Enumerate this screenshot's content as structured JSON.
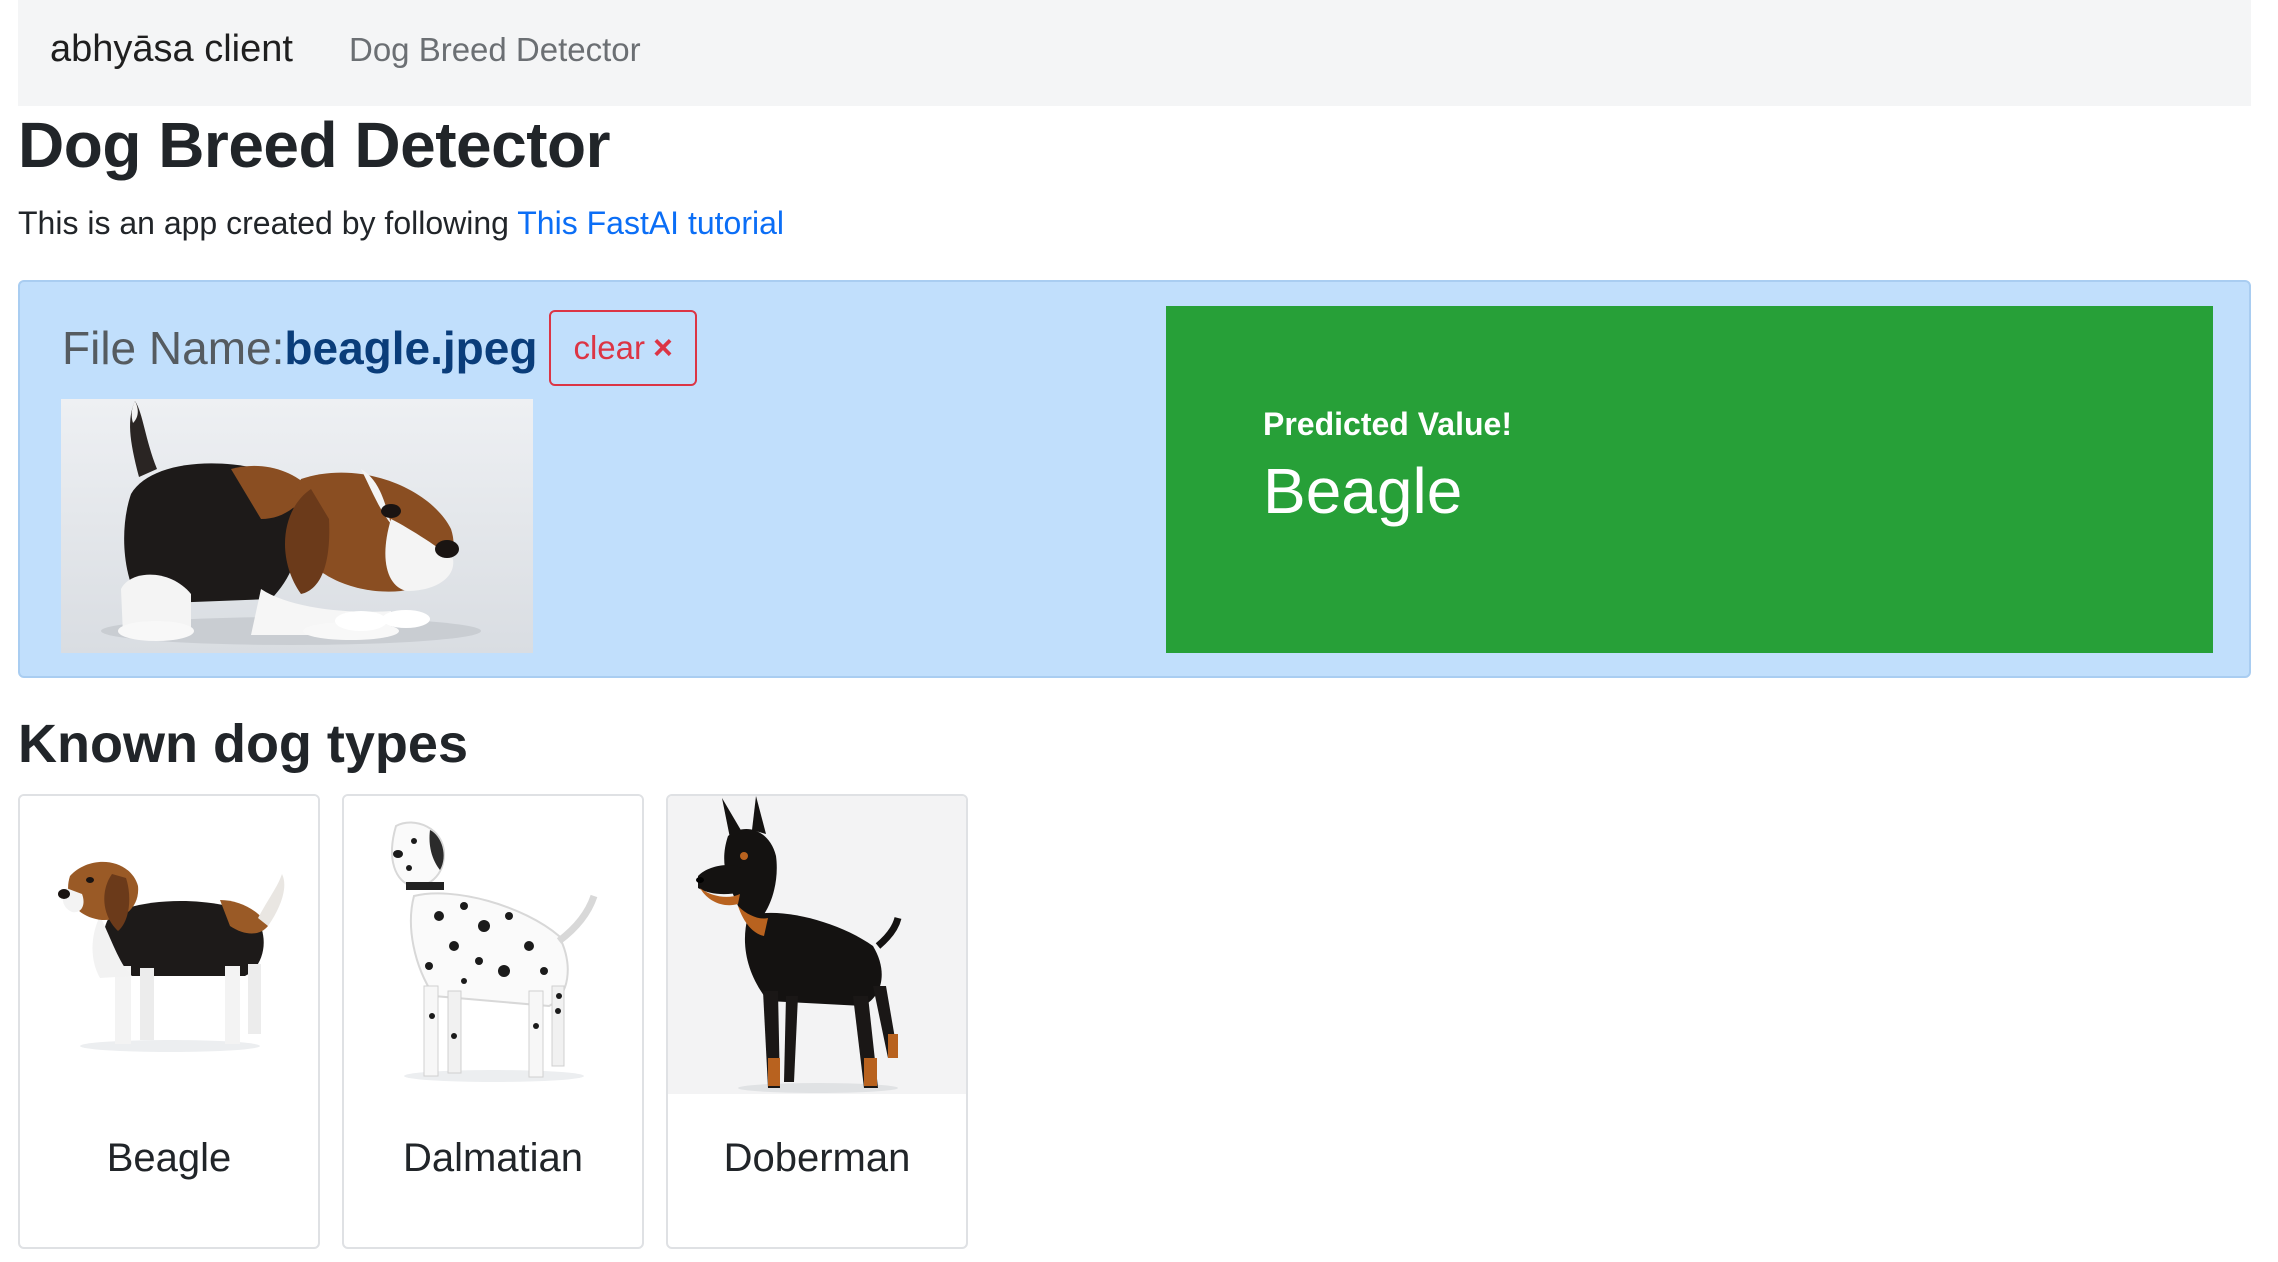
{
  "navbar": {
    "brand": "abhyāsa client",
    "link": "Dog Breed Detector"
  },
  "page": {
    "title": "Dog Breed Detector",
    "intro_text": "This is an app created by following ",
    "intro_link": "This FastAI tutorial"
  },
  "upload": {
    "file_label": "File Name:",
    "file_name": "beagle.jpeg",
    "clear_label": "clear",
    "clear_icon": "×"
  },
  "prediction": {
    "label": "Predicted Value!",
    "value": "Beagle"
  },
  "known": {
    "title": "Known dog types",
    "cards": [
      {
        "name": "Beagle"
      },
      {
        "name": "Dalmatian"
      },
      {
        "name": "Doberman"
      }
    ]
  },
  "colors": {
    "panel_bg": "#c1dffc",
    "prediction_bg": "#27a038",
    "link": "#0b6ef6",
    "danger": "#dc3545"
  }
}
